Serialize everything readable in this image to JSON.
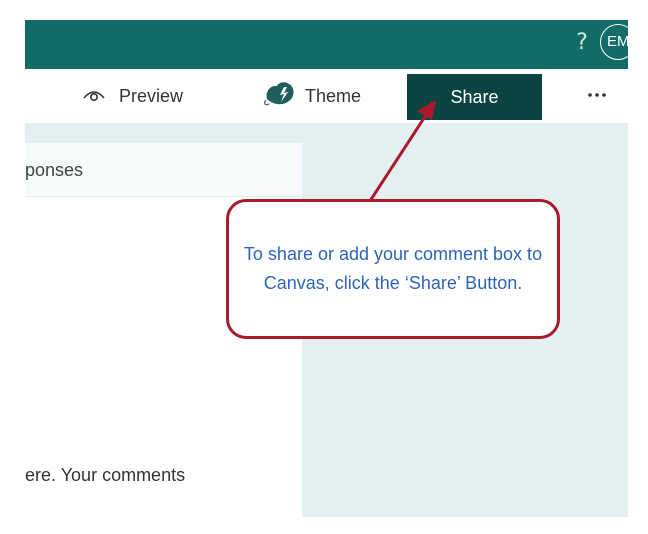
{
  "topbar": {
    "help_glyph": "?",
    "avatar_initials": "EM",
    "bg_color": "#146c69"
  },
  "toolbar": {
    "preview_label": "Preview",
    "preview_icon": "eye-icon",
    "theme_label": "Theme",
    "theme_icon": "palette-icon",
    "share_label": "Share",
    "more_icon": "more-horizontal-icon",
    "share_color": "#0c4441"
  },
  "form": {
    "responses_tab_label": "ponses",
    "comments_text": "ere. Your comments"
  },
  "callout": {
    "text": "To share or add your comment box to Canvas, click the ‘Share’ Button.",
    "border_color": "#a81a2c",
    "text_color": "#2d64b8"
  }
}
